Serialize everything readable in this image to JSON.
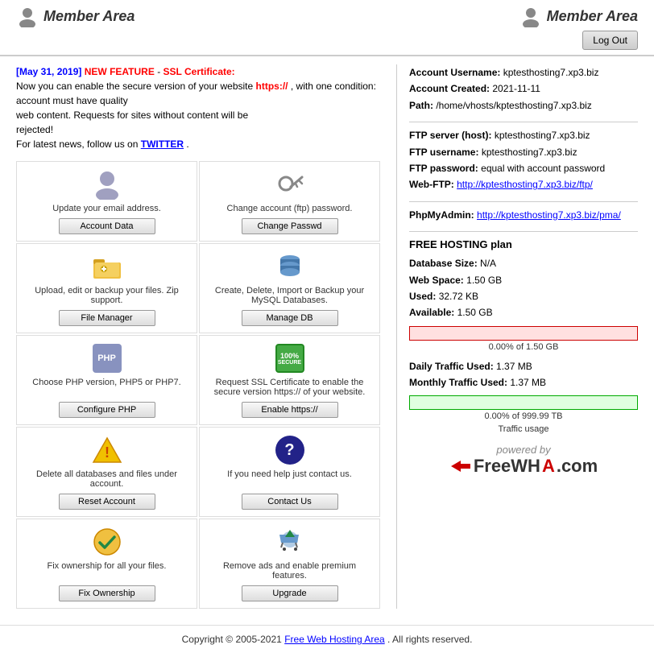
{
  "header": {
    "left_title": "Member Area",
    "right_title": "Member Area",
    "logout_label": "Log Out"
  },
  "announcement": {
    "date": "[May 31, 2019]",
    "new_label": "NEW FEATURE",
    "dash": " - ",
    "ssl_label": "SSL Certificate:",
    "line1": "Now you can enable the secure version of your website",
    "https_label": "https://",
    "line2": ", with one condition: account must have quality",
    "line3": "web content. Requests for sites without content will be",
    "line4": "rejected!",
    "news_line": "For latest news, follow us on",
    "twitter": "TWITTER",
    "period": "."
  },
  "grid": {
    "cells": [
      {
        "desc": "Update your email address.",
        "btn_label": "Account Data",
        "icon": "user"
      },
      {
        "desc": "Change account (ftp) password.",
        "btn_label": "Change Passwd",
        "icon": "key"
      },
      {
        "desc": "Upload, edit or backup your files. Zip support.",
        "btn_label": "File Manager",
        "icon": "folder",
        "has_arrow": true
      },
      {
        "desc": "Create, Delete, Import or Backup your MySQL Databases.",
        "btn_label": "Manage DB",
        "icon": "db"
      },
      {
        "desc": "Choose PHP version, PHP5 or PHP7.",
        "btn_label": "Configure PHP",
        "icon": "php"
      },
      {
        "desc": "Request SSL Certificate to enable the secure version https:// of your website.",
        "btn_label": "Enable https://",
        "icon": "ssl"
      },
      {
        "desc": "Delete all databases and files under account.",
        "btn_label": "Reset Account",
        "icon": "warning"
      },
      {
        "desc": "If you need help just contact us.",
        "btn_label": "Contact Us",
        "icon": "question"
      },
      {
        "desc": "Fix ownership for all your files.",
        "btn_label": "Fix Ownership",
        "icon": "check"
      },
      {
        "desc": "Remove ads and enable premium features.",
        "btn_label": "Upgrade",
        "icon": "cart"
      }
    ]
  },
  "account": {
    "username_label": "Account Username:",
    "username_value": "kptesthosting7.xp3.biz",
    "created_label": "Account Created:",
    "created_value": "2021-11-11",
    "path_label": "Path:",
    "path_value": "/home/vhosts/kptesthosting7.xp3.biz",
    "ftp_server_label": "FTP server (host):",
    "ftp_server_value": "kptesthosting7.xp3.biz",
    "ftp_username_label": "FTP username:",
    "ftp_username_value": "kptesthosting7.xp3.biz",
    "ftp_password_label": "FTP password:",
    "ftp_password_value": "equal with account password",
    "web_ftp_label": "Web-FTP:",
    "web_ftp_value": "http://kptesthosting7.xp3.biz/ftp/",
    "phpmyadmin_label": "PhpMyAdmin:",
    "phpmyadmin_value": "http://kptesthosting7.xp3.biz/pma/"
  },
  "hosting": {
    "plan_title": "FREE HOSTING plan",
    "db_label": "Database Size:",
    "db_value": "N/A",
    "webspace_label": "Web Space:",
    "webspace_value": "1.50 GB",
    "used_label": "Used:",
    "used_value": "32.72 KB",
    "available_label": "Available:",
    "available_value": "1.50 GB",
    "storage_progress": "0.00% of 1.50 GB",
    "daily_traffic_label": "Daily Traffic Used:",
    "daily_traffic_value": "1.37 MB",
    "monthly_traffic_label": "Monthly Traffic Used:",
    "monthly_traffic_value": "1.37 MB",
    "traffic_progress": "0.00% of 999.99 TB",
    "traffic_label": "Traffic usage"
  },
  "powered": {
    "text": "powered by",
    "brand_free": "FreeWH",
    "brand_a": "A",
    "brand_com": ".com"
  },
  "footer": {
    "copyright": "Copyright © 2005-2021",
    "link_text": "Free Web Hosting Area",
    "rights": ". All rights reserved."
  }
}
